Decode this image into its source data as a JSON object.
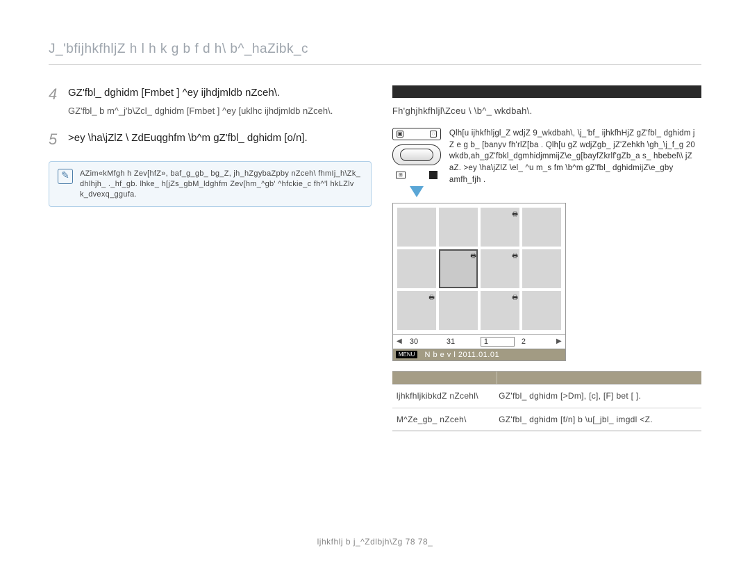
{
  "header": {
    "title": "J_'bfijhkfhljZ h l h k g b f d h\\ b^_haZibk_c"
  },
  "left": {
    "step4": {
      "num": "4",
      "text": "GZ'fbl_ dghidm [Fmbet ] ^ey ijhdjmldb nZceh\\.",
      "sub": "GZ'fbl_ b m^_j'b\\Zcl_ dghidm [Fmbet ] ^ey [uklhc ijhdjmldb nZceh\\."
    },
    "step5": {
      "num": "5",
      "text": ">ey \\ha\\jZlZ \\ ZdEuqghfm \\b^m gZ'fbl_ dghidm [o/n]."
    },
    "note": "AZim«kMfgh h Zev[hfZ», baf_g_gb_ bg_Z, jh_hZgybaZpby nZceh\\ fhmIj_h\\Zk_ dhlhjh_ ._hf_gb. lhke_ h[jZs_gbM_ldghfm Zev[hm_^gb' ^hfckie_c fh^'l hkLZlv k_dvexq_ggufa."
  },
  "right": {
    "intro": "Fh'ghjhkfhljl\\Zceu \\ \\b^_ wkdbah\\.",
    "camera_text": "Qlh[u ijhkfhljgl_Z wdjZ 9_wkdbah\\, \\j_'bf_ ijhkfhHjZ gZ'fbl_ dghidm j Z e g b_ [banyv fh'rlZ[ba . Qlh[u gZ wdjZgb_ jZ'Zehkh \\gh_\\j_f_g 20 wkdb,ah_gZ'fbkl_dgmhidjmmijZ\\e_g[bayfZkrlf'gZb_a s_ hbebel\\\\ jZ aZ. >ey \\ha\\jZlZ \\el_ ^u m_s fm \\b^m gZ'fbl_ dghidmijZ\\e_gby amfh_fjh .",
    "shot": {
      "menu": "MENU",
      "label": "N b e v l 2011.01.01",
      "nav_a": "30",
      "nav_b": "31",
      "nav_c": "1",
      "nav_d": "2"
    },
    "table": {
      "h1": "~",
      "h2": "~",
      "r1c1": "ljhkfhljkibkdZ\nnZcehl\\",
      "r1c2": "GZ'fbl_ dghidm [>Dm], [c], [F] bet [ ].",
      "r2c1": "M^Ze_gb_ nZceh\\",
      "r2c2": "GZ'fbl_ dghidm [f/n] b \\u[_jbl_ imgdl <Z."
    }
  },
  "footer": "ljhkfhlj b j_^Zdlbjh\\Zg 78 78_"
}
